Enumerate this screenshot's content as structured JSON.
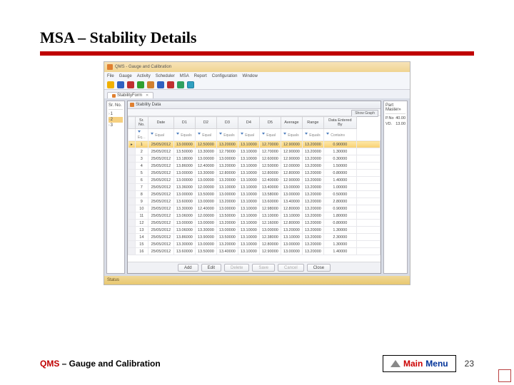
{
  "slide": {
    "title": "MSA – Stability Details",
    "footer_prefix": "QMS",
    "footer_suffix": " – Gauge and Calibration",
    "main_menu_a": "Main ",
    "main_menu_b": "Menu",
    "page_number": "23"
  },
  "app": {
    "window_title": "QMS - Gauge and Calibration",
    "menu": [
      "File",
      "Gauge",
      "Activity",
      "Scheduler",
      "MSA",
      "Report",
      "Configuration",
      "Window"
    ],
    "tab_label": "StabilityForm",
    "status": "Status",
    "data_title": "Stability Data",
    "show_graph": "Show Graph",
    "left_header": "Sr. No.",
    "left_items": [
      "1",
      "2",
      "3"
    ],
    "right_header": "Part Master»",
    "right_rows": [
      [
        "P.No",
        "40.00"
      ],
      [
        "VD.",
        "13.00"
      ]
    ],
    "columns": [
      "Sr. No.",
      "Date",
      "D1",
      "D2",
      "D3",
      "D4",
      "D5",
      "Average",
      "Range",
      "Data Entered By"
    ],
    "filter_labels": [
      "Eq…",
      "Equal",
      "Equals",
      "Equal",
      "Equals",
      "Equal",
      "Equal",
      "Equals",
      "Equals",
      "Contains"
    ],
    "rows": [
      [
        "1",
        "25/05/2012",
        "13.00000",
        "12.50000",
        "13.20000",
        "13.10000",
        "12.70000",
        "12.90000",
        "13.20000",
        "0.90000"
      ],
      [
        "2",
        "25/05/2012",
        "13.50000",
        "13.30000",
        "12.79000",
        "13.10000",
        "12.70000",
        "12.90000",
        "13.20000",
        "1.30000"
      ],
      [
        "3",
        "25/05/2012",
        "13.18000",
        "13.00000",
        "13.00000",
        "13.10000",
        "12.60000",
        "12.90000",
        "13.20000",
        "0.30000"
      ],
      [
        "4",
        "25/05/2012",
        "13.86000",
        "12.40000",
        "13.20000",
        "13.10000",
        "12.50000",
        "12.00000",
        "13.20000",
        "1.50000"
      ],
      [
        "5",
        "25/05/2012",
        "13.00000",
        "13.30000",
        "12.80000",
        "13.10000",
        "12.80000",
        "12.80000",
        "13.20000",
        "0.80000"
      ],
      [
        "6",
        "25/05/2012",
        "13.00000",
        "13.00000",
        "13.20000",
        "13.10000",
        "12.40000",
        "12.90000",
        "13.20000",
        "1.40000"
      ],
      [
        "7",
        "25/05/2012",
        "13.36000",
        "12.00000",
        "13.10000",
        "13.10000",
        "13.40000",
        "13.00000",
        "13.20000",
        "1.00000"
      ],
      [
        "8",
        "25/05/2012",
        "13.00000",
        "13.50000",
        "13.00000",
        "13.10000",
        "13.58000",
        "13.00000",
        "13.20000",
        "0.50000"
      ],
      [
        "9",
        "25/05/2012",
        "13.60000",
        "13.00000",
        "13.20000",
        "13.10000",
        "13.60000",
        "13.40000",
        "13.20000",
        "2.80000"
      ],
      [
        "10",
        "25/05/2012",
        "13.30000",
        "12.40000",
        "13.00000",
        "13.10000",
        "12.98000",
        "12.80000",
        "13.20000",
        "0.90000"
      ],
      [
        "11",
        "25/05/2012",
        "13.06000",
        "12.00000",
        "13.50000",
        "13.10000",
        "13.10000",
        "13.10000",
        "13.20000",
        "1.80000"
      ],
      [
        "12",
        "25/05/2012",
        "13.00000",
        "13.00000",
        "13.20000",
        "13.10000",
        "12.16000",
        "12.80000",
        "13.20000",
        "0.80000"
      ],
      [
        "13",
        "25/05/2012",
        "13.06000",
        "13.30000",
        "13.00000",
        "13.10000",
        "13.00000",
        "13.20000",
        "13.20000",
        "1.30000"
      ],
      [
        "14",
        "25/05/2012",
        "13.86000",
        "13.90000",
        "13.50000",
        "13.10000",
        "12.38000",
        "13.10000",
        "13.20000",
        "2.30000"
      ],
      [
        "15",
        "25/05/2012",
        "13.30000",
        "13.00000",
        "13.20000",
        "13.10000",
        "12.80000",
        "13.00000",
        "13.20000",
        "1.30000"
      ],
      [
        "16",
        "25/05/2012",
        "13.60000",
        "13.50000",
        "13.40000",
        "13.10000",
        "12.90000",
        "13.00000",
        "13.20000",
        "1.40000"
      ]
    ],
    "buttons": [
      "Add",
      "Edit",
      "Delete",
      "Save",
      "Cancel",
      "Close"
    ]
  }
}
